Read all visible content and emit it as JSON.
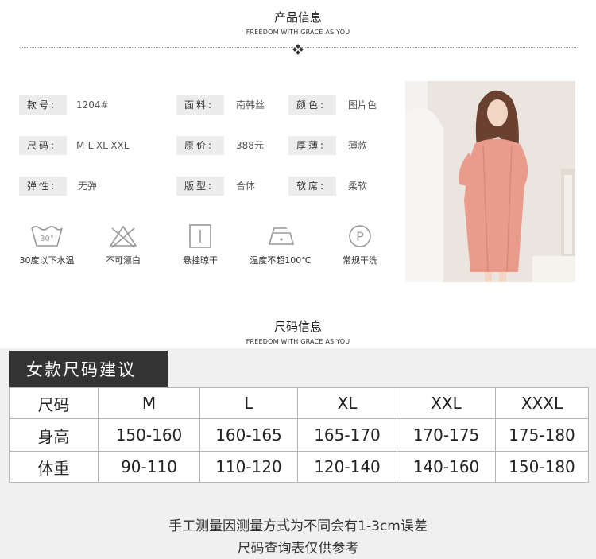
{
  "product_section": {
    "title": "产品信息",
    "subtitle": "FREEDOM WITH GRACE AS YOU"
  },
  "attributes": [
    {
      "label": "款号:",
      "value": "1204#"
    },
    {
      "label": "面料:",
      "value": "南韩丝"
    },
    {
      "label": "颜色:",
      "value": "图片色"
    },
    {
      "label": "尺码:",
      "value": "M-L-XL-XXL"
    },
    {
      "label": "原价:",
      "value": "388元"
    },
    {
      "label": "厚薄:",
      "value": "薄款"
    },
    {
      "label": "弹性:",
      "value": "无弹"
    },
    {
      "label": "版型:",
      "value": "合体"
    },
    {
      "label": "软席:",
      "value": "柔软"
    }
  ],
  "care": [
    {
      "icon": "wash-30-icon",
      "label": "30度以下水温",
      "icon_text": "30°"
    },
    {
      "icon": "no-bleach-icon",
      "label": "不可漂白"
    },
    {
      "icon": "hang-dry-icon",
      "label": "悬挂晾干"
    },
    {
      "icon": "iron-icon",
      "label": "温度不超100℃"
    },
    {
      "icon": "dry-clean-icon",
      "label": "常规干洗",
      "icon_text": "P"
    }
  ],
  "size_section": {
    "title": "尺码信息",
    "subtitle": "FREEDOM WITH GRACE AS YOU",
    "table_title": "女款尺码建议",
    "columns": [
      "尺码",
      "M",
      "L",
      "XL",
      "XXL",
      "XXXL"
    ],
    "rows": [
      [
        "身高",
        "150-160",
        "160-165",
        "165-170",
        "170-175",
        "175-180"
      ],
      [
        "体重",
        "90-110",
        "110-120",
        "120-140",
        "140-160",
        "150-180"
      ]
    ],
    "notes": [
      "手工测量因测量方式为不同会有1-3cm误差",
      "尺码查询表仅供参考"
    ]
  },
  "colors": {
    "dress": "#e79a8b",
    "header_bg": "#333333",
    "panel_bg": "#f0f0f0"
  }
}
